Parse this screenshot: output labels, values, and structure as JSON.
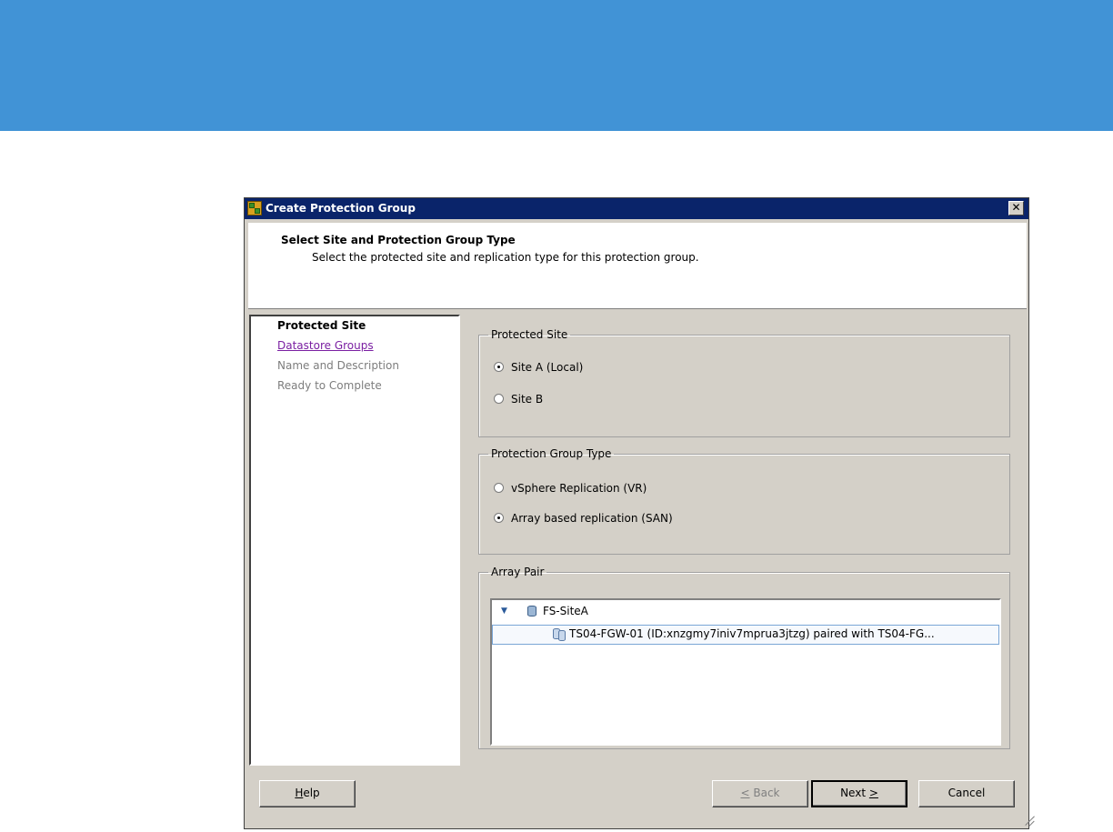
{
  "window": {
    "title": "Create Protection Group",
    "close_glyph": "✕"
  },
  "header": {
    "title": "Select Site and Protection Group Type",
    "subtitle": "Select the protected site and replication type for this protection group."
  },
  "nav": {
    "items": [
      {
        "label": "Protected Site",
        "state": "current"
      },
      {
        "label": "Datastore Groups",
        "state": "link"
      },
      {
        "label": "Name and Description",
        "state": "disabled"
      },
      {
        "label": "Ready to Complete",
        "state": "disabled"
      }
    ]
  },
  "protected_site": {
    "legend": "Protected Site",
    "options": [
      {
        "label": "Site A (Local)",
        "selected": true
      },
      {
        "label": "Site B",
        "selected": false
      }
    ]
  },
  "group_type": {
    "legend": "Protection Group Type",
    "options": [
      {
        "label": "vSphere Replication (VR)",
        "selected": false
      },
      {
        "label": "Array based replication (SAN)",
        "selected": true
      }
    ]
  },
  "array_pair": {
    "legend": "Array Pair",
    "root": {
      "label": "FS-SiteA",
      "expanded": true
    },
    "child": {
      "label": "TS04-FGW-01  (ID:xnzgmy7iniv7mprua3jtzg)  paired  with  TS04-FG..."
    }
  },
  "buttons": {
    "help": {
      "mnemonic": "H",
      "rest": "elp"
    },
    "back": {
      "mnemonic": "<",
      "rest": " Back",
      "disabled": true
    },
    "next": {
      "pre": "Next ",
      "mnemonic": ">"
    },
    "cancel": "Cancel"
  }
}
